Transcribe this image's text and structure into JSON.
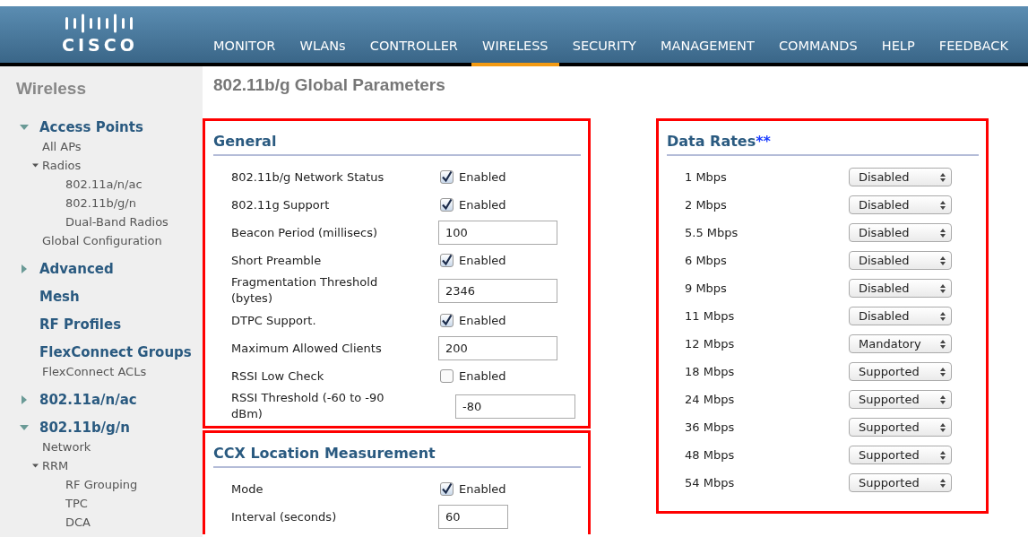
{
  "header": {
    "logo_text": "CISCO",
    "nav": [
      {
        "label": "MONITOR",
        "selected": false
      },
      {
        "label": "WLANs",
        "selected": false
      },
      {
        "label": "CONTROLLER",
        "selected": false
      },
      {
        "label": "WIRELESS",
        "selected": true
      },
      {
        "label": "SECURITY",
        "selected": false
      },
      {
        "label": "MANAGEMENT",
        "selected": false
      },
      {
        "label": "COMMANDS",
        "selected": false
      },
      {
        "label": "HELP",
        "selected": false
      },
      {
        "label": "FEEDBACK",
        "selected": false
      }
    ]
  },
  "sidebar": {
    "title": "Wireless",
    "items": [
      {
        "label": "Access Points",
        "expanded": true,
        "children": [
          {
            "label": "All APs"
          },
          {
            "label": "Radios",
            "expanded": true,
            "children": [
              {
                "label": "802.11a/n/ac"
              },
              {
                "label": "802.11b/g/n"
              },
              {
                "label": "Dual-Band Radios"
              }
            ]
          },
          {
            "label": "Global Configuration"
          }
        ]
      },
      {
        "label": "Advanced",
        "expanded": false
      },
      {
        "label": "Mesh"
      },
      {
        "label": "RF Profiles"
      },
      {
        "label": "FlexConnect Groups",
        "children": [
          {
            "label": "FlexConnect ACLs"
          }
        ]
      },
      {
        "label": "802.11a/n/ac",
        "expanded": false
      },
      {
        "label": "802.11b/g/n",
        "expanded": true,
        "children": [
          {
            "label": "Network"
          },
          {
            "label": "RRM",
            "expanded": true,
            "children": [
              {
                "label": "RF Grouping"
              },
              {
                "label": "TPC"
              },
              {
                "label": "DCA"
              }
            ]
          }
        ]
      }
    ]
  },
  "page_title": "802.11b/g Global Parameters",
  "general": {
    "title": "General",
    "rows": [
      {
        "label": "802.11b/g Network Status",
        "kind": "checkbox",
        "checked": true,
        "text": "Enabled"
      },
      {
        "label": "802.11g Support",
        "kind": "checkbox",
        "checked": true,
        "text": "Enabled"
      },
      {
        "label": "Beacon Period (millisecs)",
        "kind": "input",
        "value": "100"
      },
      {
        "label": "Short Preamble",
        "kind": "checkbox",
        "checked": true,
        "text": "Enabled"
      },
      {
        "label": "Fragmentation Threshold (bytes)",
        "kind": "input",
        "value": "2346"
      },
      {
        "label": "DTPC Support.",
        "kind": "checkbox",
        "checked": true,
        "text": "Enabled"
      },
      {
        "label": "Maximum Allowed Clients",
        "kind": "input",
        "value": "200"
      },
      {
        "label": "RSSI Low Check",
        "kind": "checkbox",
        "checked": false,
        "text": "Enabled"
      },
      {
        "label": "RSSI Threshold (-60 to -90 dBm)",
        "kind": "input_offset",
        "value": "-80"
      }
    ]
  },
  "ccx": {
    "title": "CCX Location Measurement",
    "rows": [
      {
        "label": "Mode",
        "kind": "checkbox",
        "checked": true,
        "text": "Enabled"
      },
      {
        "label": "Interval (seconds)",
        "kind": "input_short",
        "value": "60"
      }
    ]
  },
  "data_rates": {
    "title": "Data Rates",
    "marker": "**",
    "rows": [
      {
        "label": "1 Mbps",
        "value": "Disabled"
      },
      {
        "label": "2 Mbps",
        "value": "Disabled"
      },
      {
        "label": "5.5 Mbps",
        "value": "Disabled"
      },
      {
        "label": "6 Mbps",
        "value": "Disabled"
      },
      {
        "label": "9 Mbps",
        "value": "Disabled"
      },
      {
        "label": "11 Mbps",
        "value": "Disabled"
      },
      {
        "label": "12 Mbps",
        "value": "Mandatory"
      },
      {
        "label": "18 Mbps",
        "value": "Supported"
      },
      {
        "label": "24 Mbps",
        "value": "Supported"
      },
      {
        "label": "36 Mbps",
        "value": "Supported"
      },
      {
        "label": "48 Mbps",
        "value": "Supported"
      },
      {
        "label": "54 Mbps",
        "value": "Supported"
      }
    ]
  }
}
